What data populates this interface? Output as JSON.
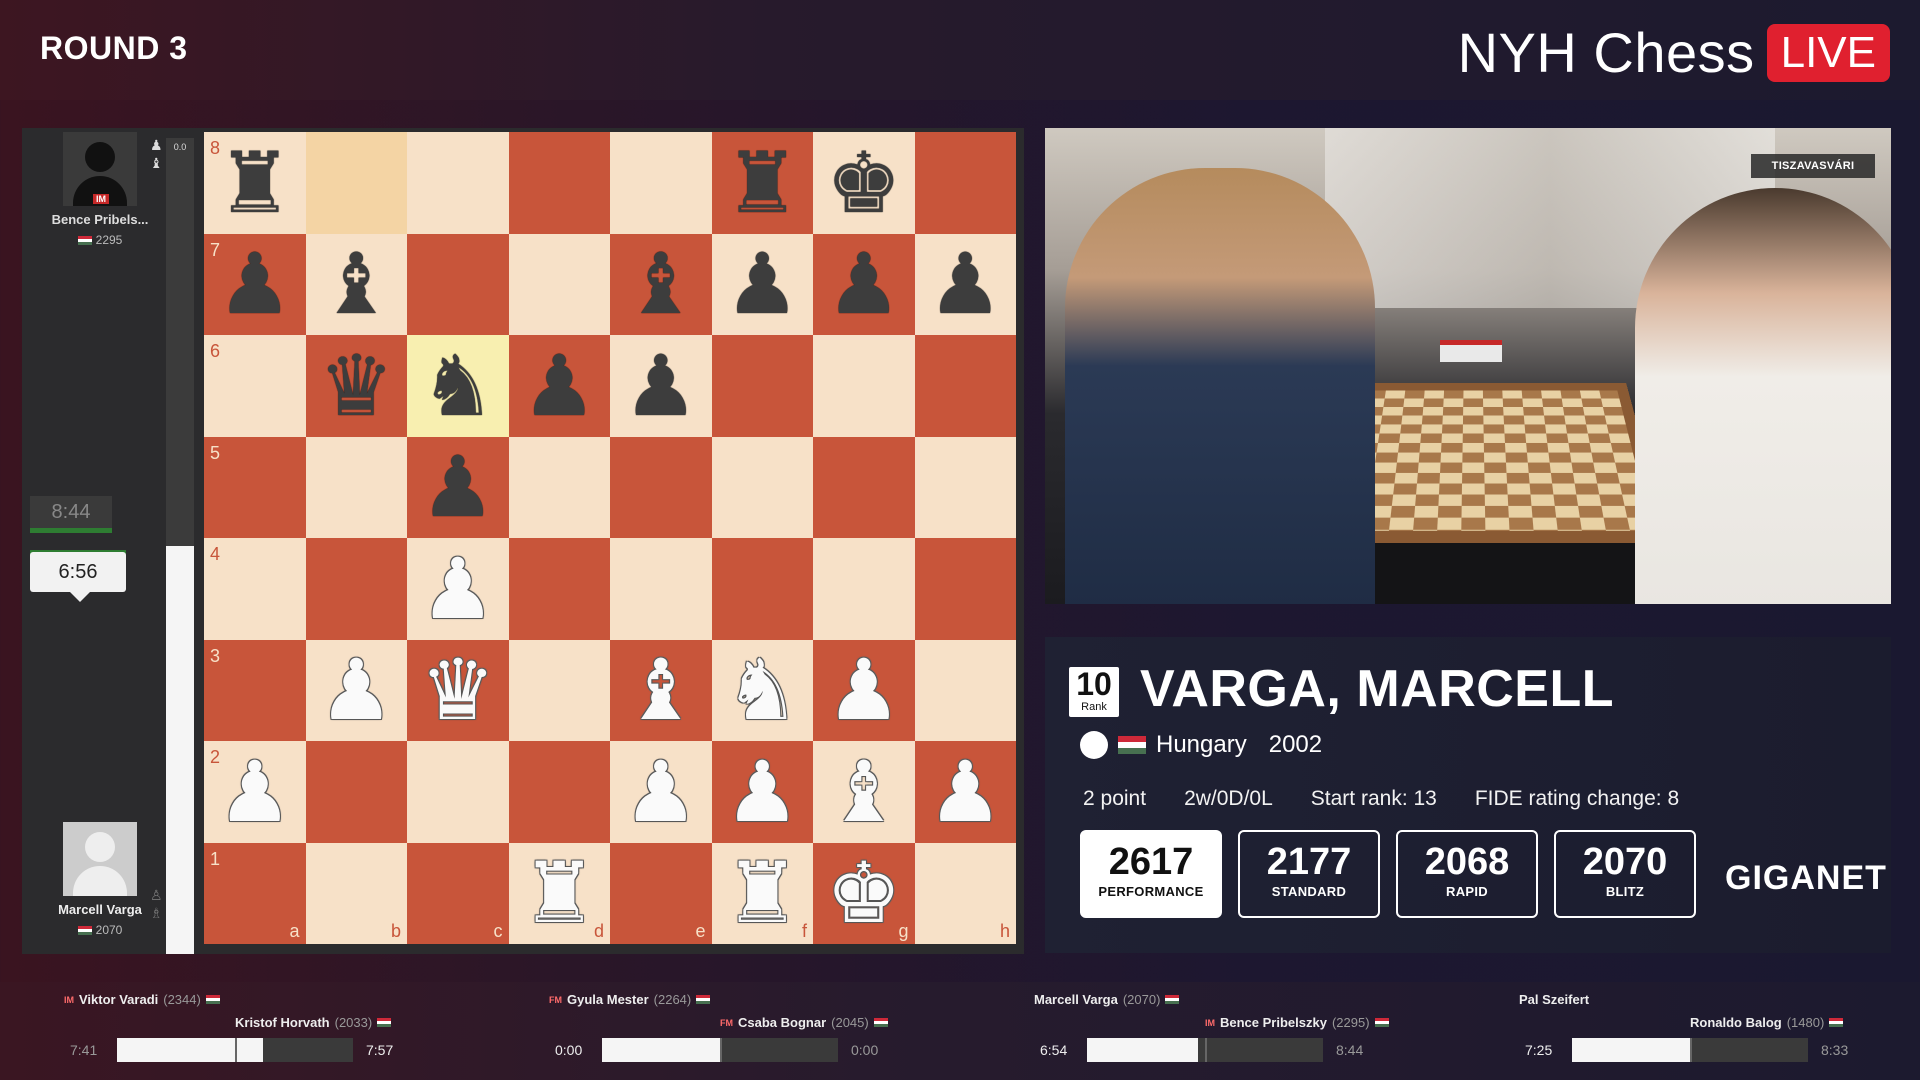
{
  "header": {
    "round": "ROUND 3",
    "brand": "NYH Chess",
    "live": "LIVE"
  },
  "board_panel": {
    "top_player": {
      "title": "IM",
      "name": "Bence Pribels...",
      "rating": "2295"
    },
    "bottom_player": {
      "name": "Marcell Varga",
      "rating": "2070"
    },
    "eval": "0.0",
    "eval_white_fraction": 0.5,
    "clock_inactive": "8:44",
    "clock_active": "6:56",
    "ranks": [
      "8",
      "7",
      "6",
      "5",
      "4",
      "3",
      "2",
      "1"
    ],
    "files": [
      "a",
      "b",
      "c",
      "d",
      "e",
      "f",
      "g",
      "h"
    ],
    "position": [
      [
        "br",
        "",
        "",
        "",
        "",
        "br",
        "bk",
        ""
      ],
      [
        "bp",
        "bb",
        "",
        "",
        "bb",
        "bp",
        "bp",
        "bp"
      ],
      [
        "",
        "bq",
        "bn",
        "bp",
        "bp",
        "",
        "",
        ""
      ],
      [
        "",
        "",
        "bp",
        "",
        "",
        "",
        "",
        ""
      ],
      [
        "",
        "",
        "wp",
        "",
        "",
        "",
        "",
        ""
      ],
      [
        "",
        "wp",
        "wq",
        "",
        "wb",
        "wn",
        "wp",
        ""
      ],
      [
        "wp",
        "",
        "",
        "",
        "wp",
        "wp",
        "wb",
        "wp"
      ],
      [
        "",
        "",
        "",
        "wr",
        "",
        "wr",
        "wk",
        ""
      ]
    ],
    "highlighted_squares": [
      "b8",
      "c6"
    ]
  },
  "camera": {
    "overlay_label": "TISZAVASVÁRI"
  },
  "player_card": {
    "rank_number": "10",
    "rank_label": "Rank",
    "name": "VARGA, MARCELL",
    "country": "Hungary",
    "birth_year": "2002",
    "points": "2 point",
    "record": "2w/0D/0L",
    "start_rank": "Start rank: 13",
    "fide_change": "FIDE rating change: 8",
    "ratings": [
      {
        "value": "2617",
        "label": "PERFORMANCE"
      },
      {
        "value": "2177",
        "label": "STANDARD"
      },
      {
        "value": "2068",
        "label": "RAPID"
      },
      {
        "value": "2070",
        "label": "BLITZ"
      }
    ],
    "sponsor": "GIGANET"
  },
  "ticker": {
    "games": [
      {
        "white": "Viktor Varadi",
        "white_title": "IM",
        "white_rating": "(2344)",
        "black": "Kristof Horvath",
        "black_title": "",
        "black_rating": "(2033)",
        "white_clock": "7:41",
        "black_clock": "7:57",
        "white_fraction": 0.62,
        "white_active": false,
        "black_active": true
      },
      {
        "white": "Gyula Mester",
        "white_title": "FM",
        "white_rating": "(2264)",
        "black": "Csaba Bognar",
        "black_title": "FM",
        "black_rating": "(2045)",
        "white_clock": "0:00",
        "black_clock": "0:00",
        "white_fraction": 0.5,
        "white_active": true,
        "black_active": false
      },
      {
        "white": "Marcell Varga",
        "white_title": "",
        "white_rating": "(2070)",
        "black": "Bence Pribelszky",
        "black_title": "IM",
        "black_rating": "(2295)",
        "white_clock": "6:54",
        "black_clock": "8:44",
        "white_fraction": 0.47,
        "white_active": true,
        "black_active": false
      },
      {
        "white": "Pal Szeifert",
        "white_title": "",
        "white_rating": "",
        "black": "Ronaldo Balog",
        "black_title": "",
        "black_rating": "(1480)",
        "white_clock": "7:25",
        "black_clock": "8:33",
        "white_fraction": 0.5,
        "white_active": true,
        "black_active": false
      }
    ]
  }
}
